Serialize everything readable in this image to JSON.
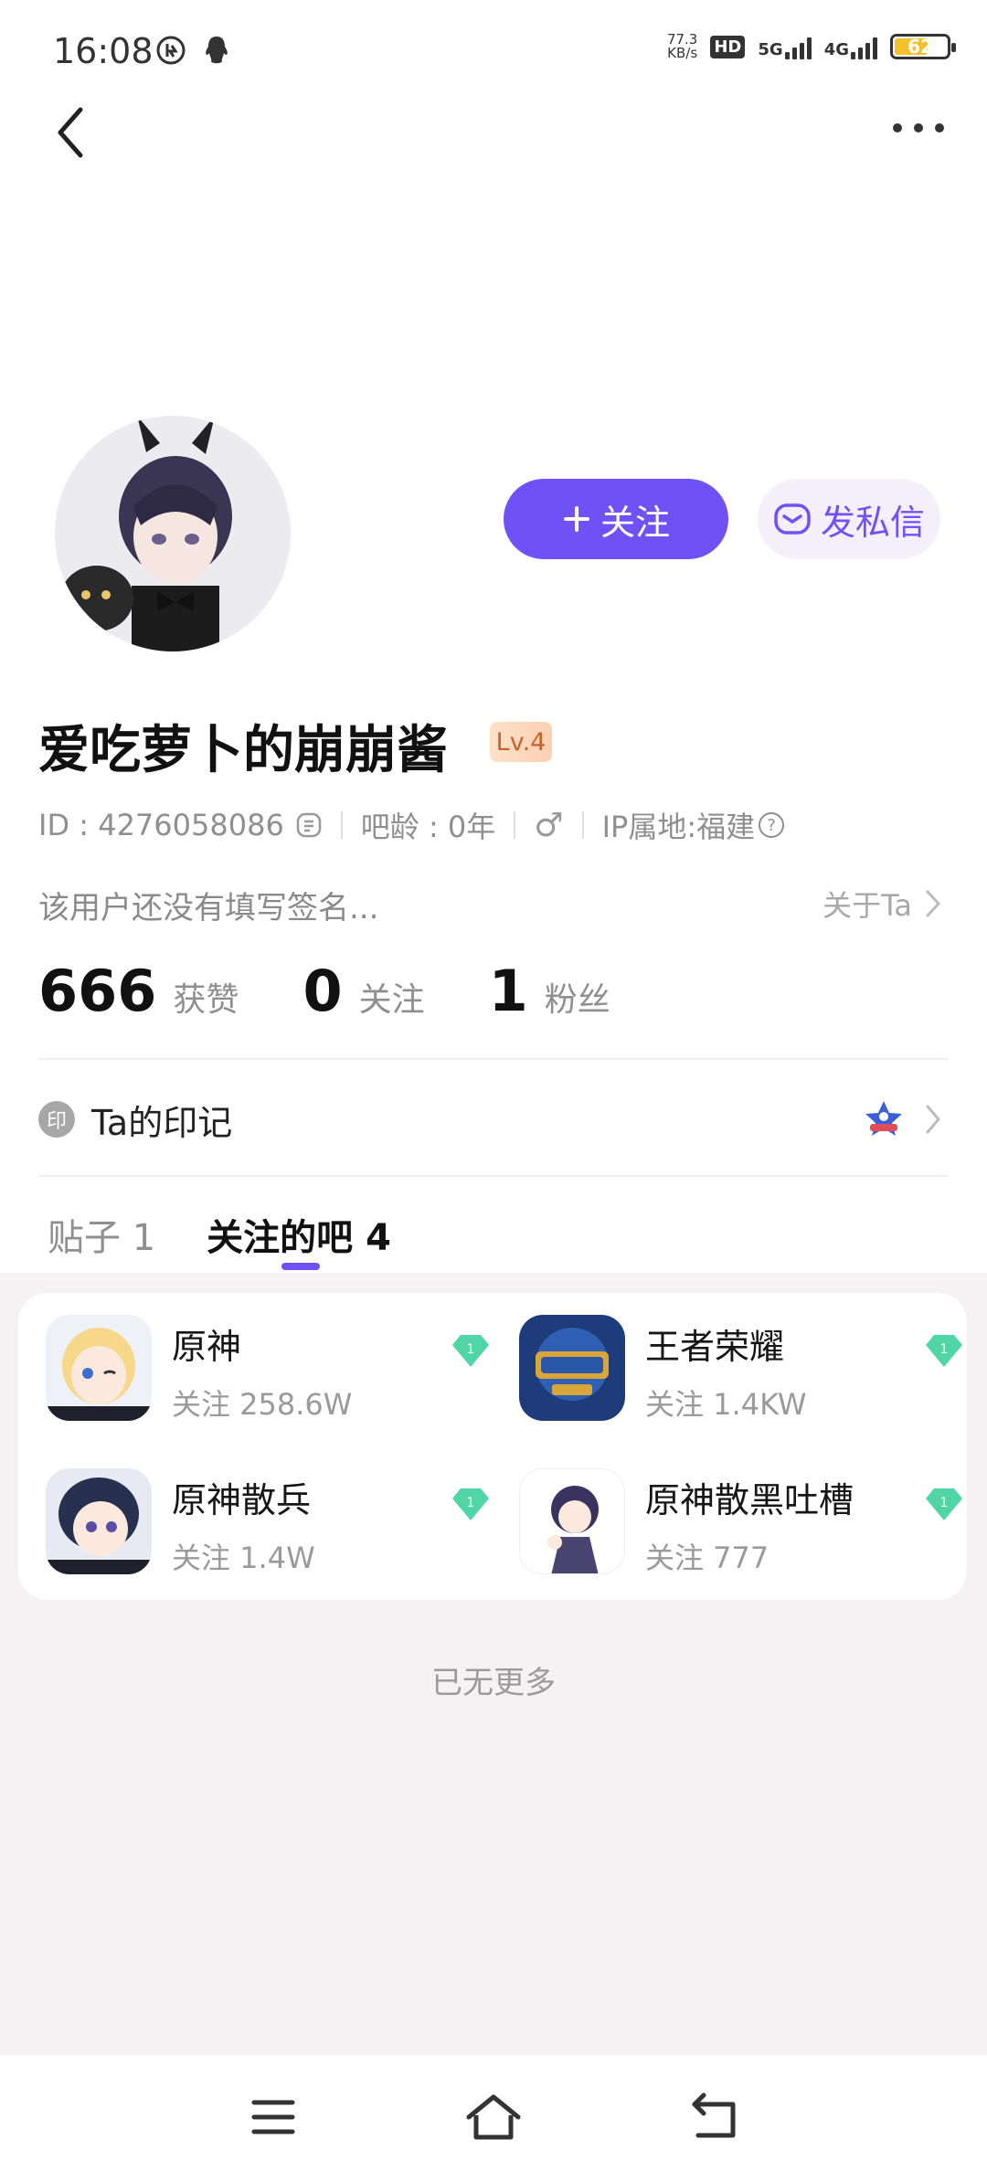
{
  "status": {
    "time": "16:08",
    "net_speed_value": "77.3",
    "net_speed_unit": "KB/s",
    "hd": "HD",
    "sig1": "5G",
    "sig2": "4G",
    "battery": "62"
  },
  "profile": {
    "username": "爱吃萝卜的崩崩酱",
    "level": "Lv.4",
    "follow_label": "关注",
    "message_label": "发私信",
    "id_text": "ID : 4276058086",
    "bar_age": "吧龄 : 0年",
    "gender_symbol": "♂",
    "ip_location": "IP属地:福建",
    "ip_help": "?",
    "signature": "该用户还没有填写签名...",
    "about_label": "关于Ta"
  },
  "stats": [
    {
      "value": "666",
      "label": "获赞"
    },
    {
      "value": "0",
      "label": "关注"
    },
    {
      "value": "1",
      "label": "粉丝"
    }
  ],
  "mark": {
    "icon_char": "印",
    "label": "Ta的印记"
  },
  "tabs": [
    {
      "label": "贴子 1",
      "active": false
    },
    {
      "label": "关注的吧 4",
      "active": true
    }
  ],
  "forums": [
    {
      "name": "原神",
      "followers": "关注 258.6W",
      "level": "1"
    },
    {
      "name": "王者荣耀",
      "followers": "关注 1.4KW",
      "level": "1"
    },
    {
      "name": "原神散兵",
      "followers": "关注 1.4W",
      "level": "1"
    },
    {
      "name": "原神散黑吐槽",
      "followers": "关注 777",
      "level": "1"
    }
  ],
  "footer_text": "已无更多",
  "colors": {
    "accent": "#6e52f5",
    "gem": "#4fd5a6",
    "content_bg": "#f6f1f3"
  },
  "icons": [
    "back-icon",
    "more-icon",
    "plus-icon",
    "mail-icon",
    "copy-icon",
    "gender-male-icon",
    "help-icon",
    "chevron-right-icon",
    "badge-star-icon",
    "gem-icon",
    "menu-icon",
    "home-icon",
    "return-icon"
  ]
}
